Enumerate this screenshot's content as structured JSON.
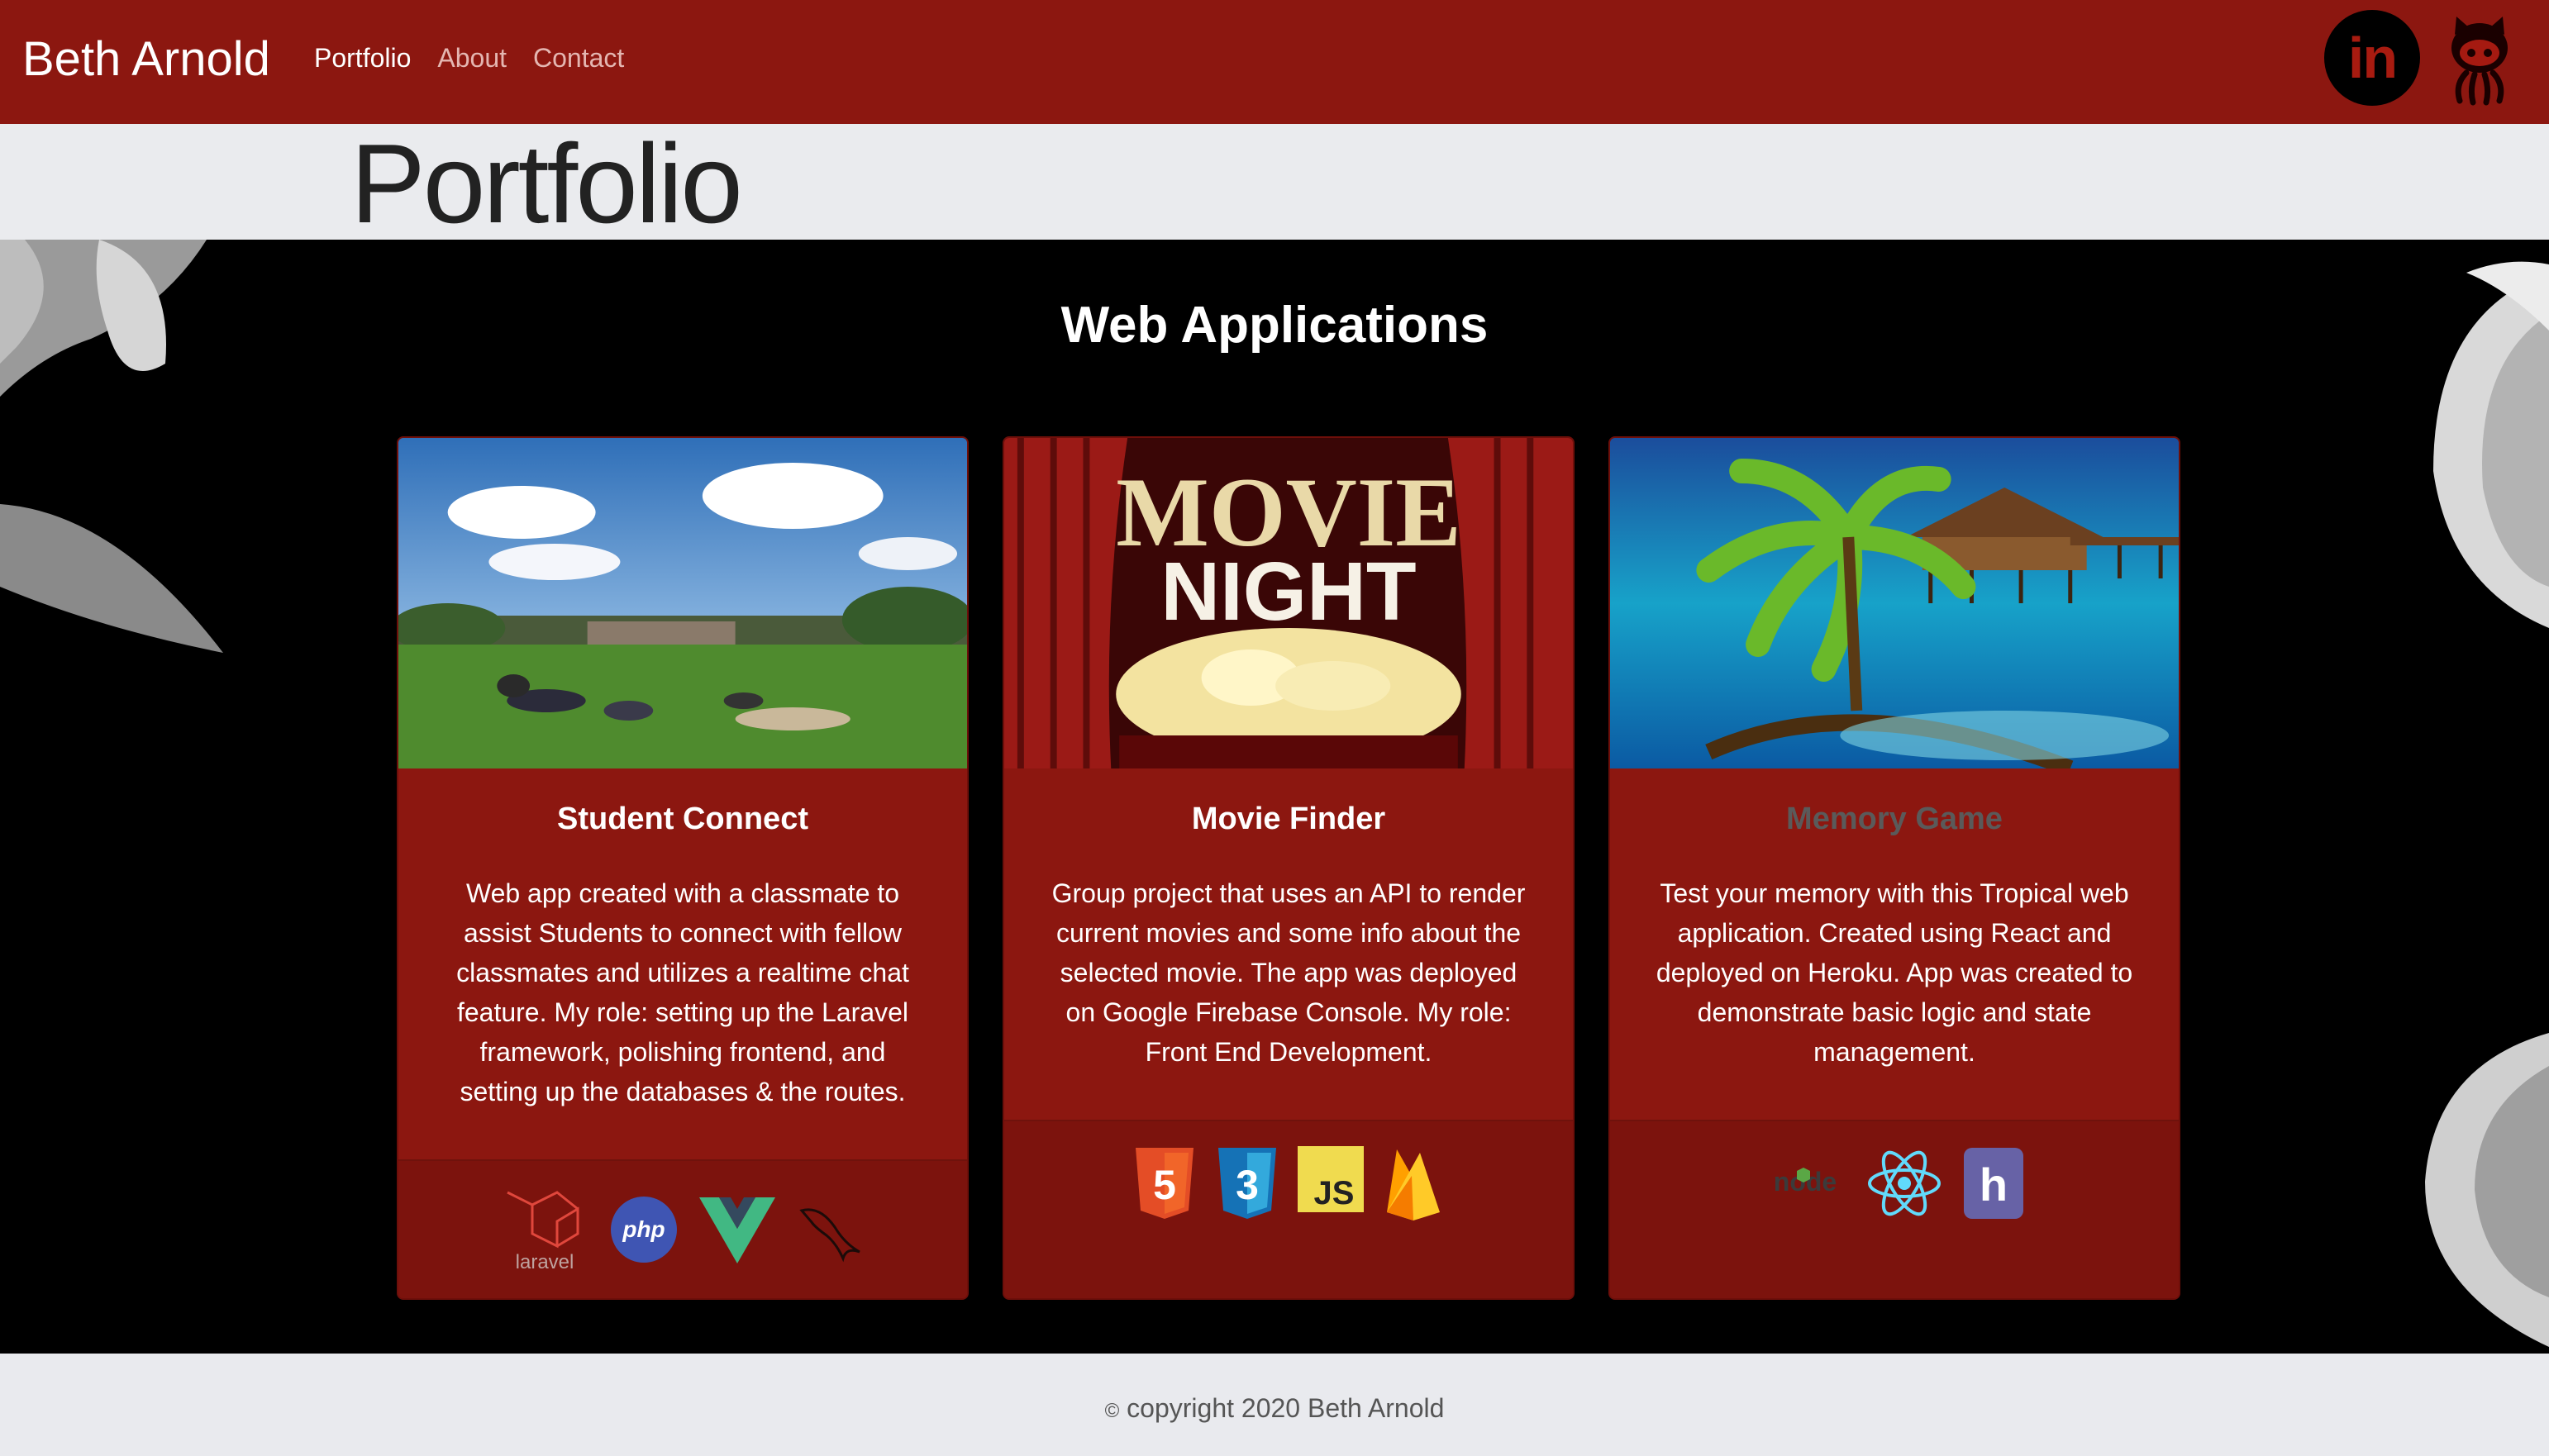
{
  "navbar": {
    "brand": "Beth Arnold",
    "links": [
      "Portfolio",
      "About",
      "Contact"
    ],
    "linkedin_text": "in",
    "bg_color": "#8c1710"
  },
  "page": {
    "title": "Portfolio"
  },
  "section": {
    "title": "Web Applications"
  },
  "cards": [
    {
      "title": "Student Connect",
      "text": "Web app created with a classmate to assist Students to connect with fellow classmates and utilizes a realtime chat feature. My role: setting up the Laravel framework, polishing frontend, and setting up the databases & the routes.",
      "tech": [
        "laravel",
        "php",
        "vue",
        "mysql"
      ],
      "laravel_label": "laravel",
      "php_label": "php"
    },
    {
      "title": "Movie Finder",
      "text": "Group project that uses an API to render current movies and some info about the selected movie. The app was deployed on Google Firebase Console. My role: Front End Development.",
      "tech": [
        "html5",
        "css3",
        "js",
        "firebase"
      ],
      "poster_line1": "MOVIE",
      "poster_line2": "NIGHT",
      "html5_label": "5",
      "css3_label": "3",
      "js_label": "JS"
    },
    {
      "title": "Memory Game",
      "text": "Test your memory with this Tropical web application. Created using React and deployed on Heroku. App was created to demonstrate basic logic and state management.",
      "tech": [
        "node",
        "react",
        "heroku"
      ],
      "node_label": "node",
      "heroku_label": "h"
    }
  ],
  "footer": {
    "copyright_symbol": "©",
    "text": "copyright 2020 Beth Arnold"
  }
}
